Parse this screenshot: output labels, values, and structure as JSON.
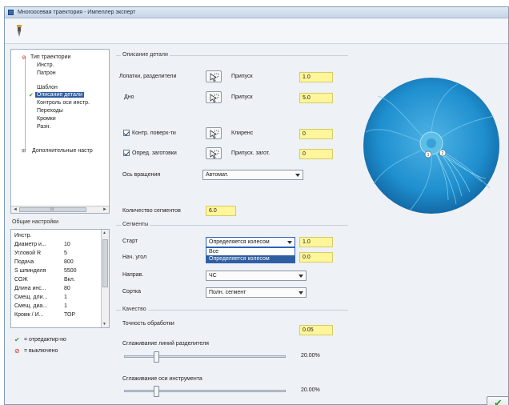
{
  "window": {
    "title": "Многоосевая траектория - Импеллер эксперт"
  },
  "tree": {
    "items": [
      {
        "label": "Тип траектории",
        "selected": false
      },
      {
        "label": "Инстр.",
        "selected": false
      },
      {
        "label": "Патрон",
        "selected": false
      },
      {
        "label": "Шаблон",
        "selected": false
      },
      {
        "label": "Описание детали",
        "selected": true
      },
      {
        "label": "Контроль оси инстр.",
        "selected": false
      },
      {
        "label": "Переходы",
        "selected": false
      },
      {
        "label": "Кромки",
        "selected": false
      },
      {
        "label": "Разн.",
        "selected": false
      },
      {
        "label": "Дополнительные настр",
        "selected": false
      }
    ],
    "scroll_left": "◄",
    "scroll_thumb": "III",
    "scroll_right": "►"
  },
  "general": {
    "title": "Общие настройки",
    "rows": [
      {
        "k": "Инстр.",
        "v": ""
      },
      {
        "k": "Диаметр и...",
        "v": "10"
      },
      {
        "k": "Угловой R",
        "v": "5"
      },
      {
        "k": "Подача",
        "v": "800"
      },
      {
        "k": "S шпинделя",
        "v": "5500"
      },
      {
        "k": "СОЖ",
        "v": "Вкл."
      },
      {
        "k": "Длина инс...",
        "v": "80"
      },
      {
        "k": "Смещ. дли...",
        "v": "1"
      },
      {
        "k": "Смещ. диа...",
        "v": "1"
      },
      {
        "k": "Кромк / И...",
        "v": "ТОР"
      }
    ],
    "scroll_up": "▲",
    "scroll_down": "▼"
  },
  "legend": {
    "edited": "= отредактир-но",
    "off": "= выключено"
  },
  "part": {
    "title": "Описание детали",
    "blades_label": "Лопатки, разделители",
    "allowance_label": "Припуск",
    "blades_allowance": "1.0",
    "floor_label": "Дно",
    "floor_allowance": "5.0",
    "ctrl_surf_label": "Контр. поверх-ти",
    "clearance_label": "Клиренс",
    "clearance_value": "0",
    "stock_label": "Опред. заготовки",
    "stock_allowance_label": "Припуск. загот.",
    "stock_allowance": "0",
    "axis_label": "Ось вращения",
    "axis_value": "Автомат.",
    "segments_label": "Количество сегментов",
    "segments_value": "6.0"
  },
  "segments": {
    "title": "Сегменты",
    "start_label": "Старт",
    "start_value": "Определяется колесом",
    "start_num": "1.0",
    "start_angle_label": "Нач. угол",
    "start_angle_value": "0.0",
    "dropdown_options": [
      "Все",
      "Определяется колесом"
    ],
    "direction_label": "Направ.",
    "direction_value": "ЧС",
    "sort_label": "Сортка",
    "sort_value": "Полн. сегмент"
  },
  "quality": {
    "title": "Качество",
    "tolerance_label": "Точность обработки",
    "tolerance_value": "0.05",
    "smooth_split_label": "Сглаживание линий разделителя",
    "smooth_split_value": "20.00%",
    "smooth_split_fraction": 0.2,
    "smooth_axis_label": "Сглаживание оси инструмента",
    "smooth_axis_value": "20.00%",
    "smooth_axis_fraction": 0.2
  },
  "viewport": {
    "marker_1": "1",
    "marker_2": "2",
    "colors": {
      "disc": "#1f8fcf",
      "disc_dark": "#136aa6",
      "hub": "#5cbfe8",
      "toolpath": "#8fe3f0"
    }
  },
  "ok_button": {
    "label": "✔"
  },
  "icons": {
    "toolbar": "tool-icon",
    "pick": "cursor-select-icon",
    "edited": "checkmark-icon",
    "off": "disabled-icon"
  }
}
